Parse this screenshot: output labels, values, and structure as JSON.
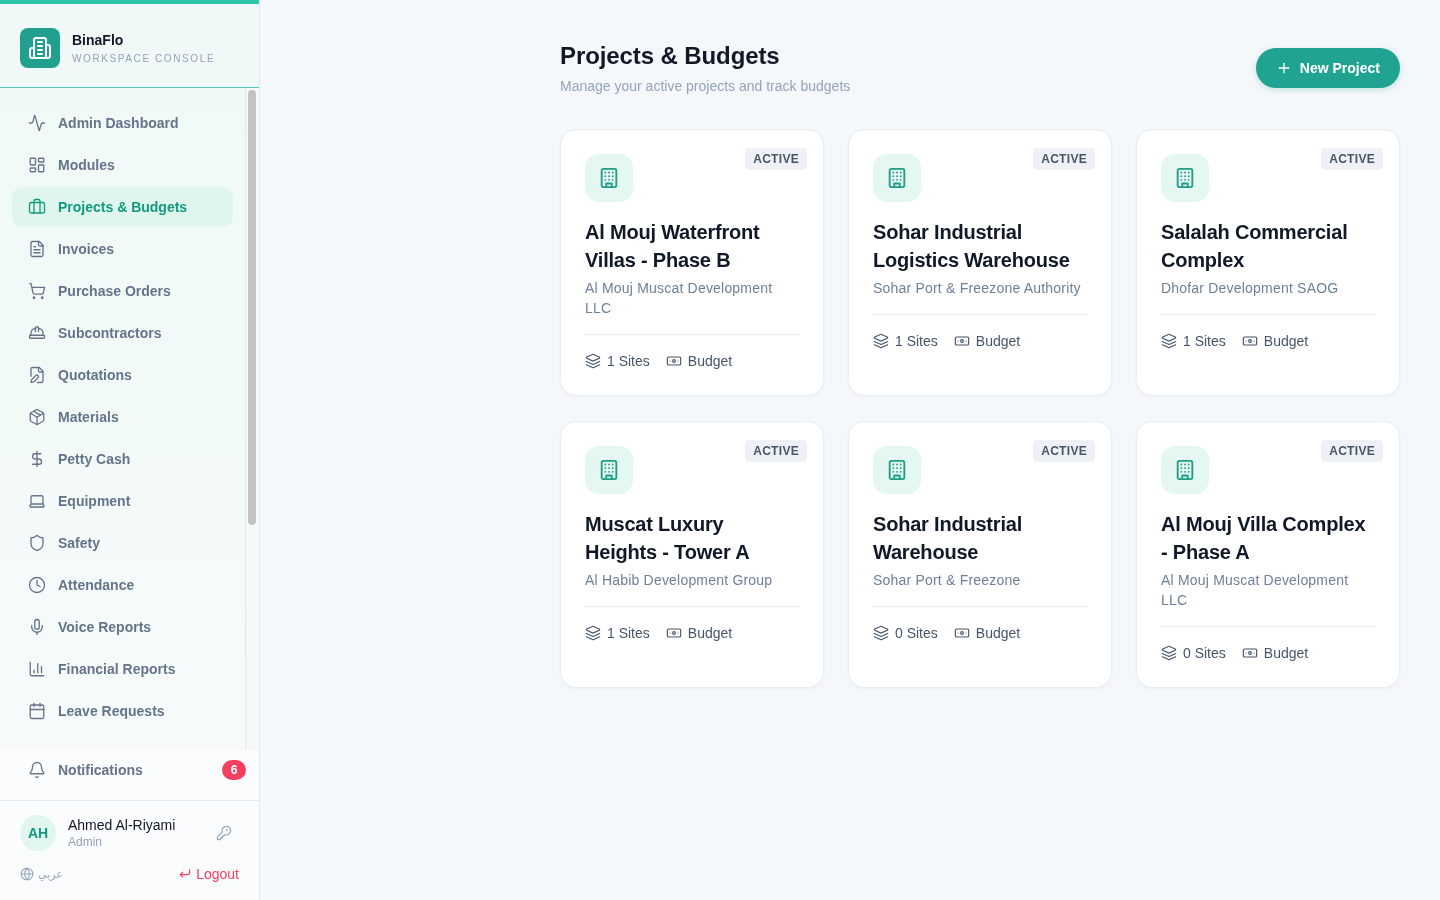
{
  "sidebar": {
    "brand": {
      "name": "BinaFlo",
      "tagline": "WORKSPACE CONSOLE"
    },
    "nav_items": [
      {
        "label": "Admin Dashboard",
        "selected": false
      },
      {
        "label": "Modules",
        "selected": false
      },
      {
        "label": "Projects & Budgets",
        "selected": true
      },
      {
        "label": "Invoices",
        "selected": false
      },
      {
        "label": "Purchase Orders",
        "selected": false
      },
      {
        "label": "Subcontractors",
        "selected": false
      },
      {
        "label": "Quotations",
        "selected": false
      },
      {
        "label": "Materials",
        "selected": false
      },
      {
        "label": "Petty Cash",
        "selected": false
      },
      {
        "label": "Equipment",
        "selected": false
      },
      {
        "label": "Safety",
        "selected": false
      },
      {
        "label": "Attendance",
        "selected": false
      },
      {
        "label": "Voice Reports",
        "selected": false
      },
      {
        "label": "Financial Reports",
        "selected": false
      },
      {
        "label": "Leave Requests",
        "selected": false
      }
    ],
    "notifications": {
      "label": "Notifications",
      "count": "6"
    },
    "user": {
      "initials": "AH",
      "name": "Ahmed Al-Riyami",
      "role": "Admin"
    },
    "language": {
      "label": "عربي",
      "selected": false
    },
    "logout": "Logout"
  },
  "header": {
    "title": "Projects & Budgets",
    "subtitle": "Manage your active projects and track budgets",
    "new_button": "New Project"
  },
  "projects": [
    {
      "status": "ACTIVE",
      "name": "Al Mouj Waterfront Villas - Phase B",
      "client": "Al Mouj Muscat Development LLC",
      "sites": "1 Sites",
      "budget": "Budget"
    },
    {
      "status": "ACTIVE",
      "name": "Sohar Industrial Logistics Warehouse",
      "client": "Sohar Port & Freezone Authority",
      "sites": "1 Sites",
      "budget": "Budget"
    },
    {
      "status": "ACTIVE",
      "name": "Salalah Commercial Complex",
      "client": "Dhofar Development SAOG",
      "sites": "1 Sites",
      "budget": "Budget"
    },
    {
      "status": "ACTIVE",
      "name": "Muscat Luxury Heights - Tower A",
      "client": "Al Habib Development Group",
      "sites": "1 Sites",
      "budget": "Budget"
    },
    {
      "status": "ACTIVE",
      "name": "Sohar Industrial Warehouse",
      "client": "Sohar Port & Freezone",
      "sites": "0 Sites",
      "budget": "Budget"
    },
    {
      "status": "ACTIVE",
      "name": "Al Mouj Villa Complex - Phase A",
      "client": "Al Mouj Muscat Development LLC",
      "sites": "0 Sites",
      "budget": "Budget"
    }
  ]
}
